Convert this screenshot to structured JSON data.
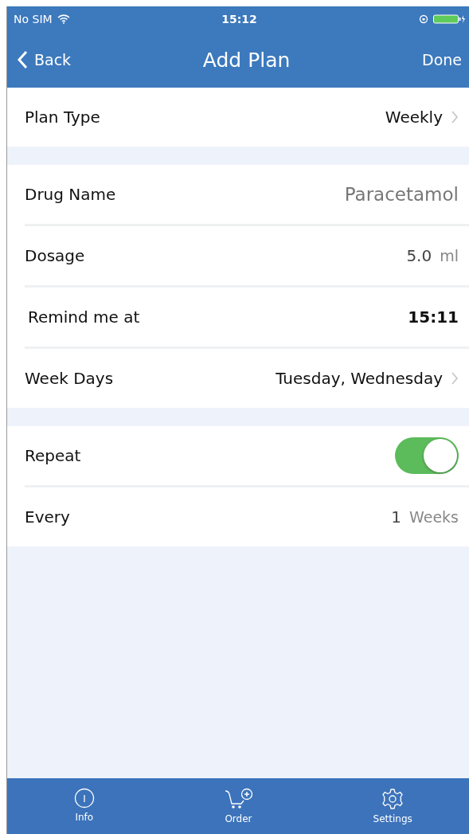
{
  "status_bar": {
    "carrier": "No SIM",
    "time": "15:12"
  },
  "nav": {
    "back": "Back",
    "title": "Add Plan",
    "done": "Done"
  },
  "sections": [
    {
      "rows": [
        {
          "kind": "link",
          "label": "Plan Type",
          "value": "Weekly"
        }
      ]
    },
    {
      "rows": [
        {
          "kind": "input",
          "label": "Drug Name",
          "value": "Paracetamol"
        },
        {
          "kind": "input",
          "label": "Dosage",
          "value": "5.0",
          "unit": "ml"
        },
        {
          "kind": "time",
          "label": "Remind me at",
          "value": "15:11"
        },
        {
          "kind": "link",
          "label": "Week Days",
          "value": "Tuesday, Wednesday"
        }
      ]
    },
    {
      "rows": [
        {
          "kind": "toggle",
          "label": "Repeat",
          "on": true
        },
        {
          "kind": "input",
          "label": "Every",
          "value": "1",
          "unit": "Weeks"
        }
      ]
    }
  ],
  "tabs": [
    {
      "kind": "info",
      "label": "Info"
    },
    {
      "kind": "order",
      "label": "Order"
    },
    {
      "kind": "settings",
      "label": "Settings"
    }
  ]
}
